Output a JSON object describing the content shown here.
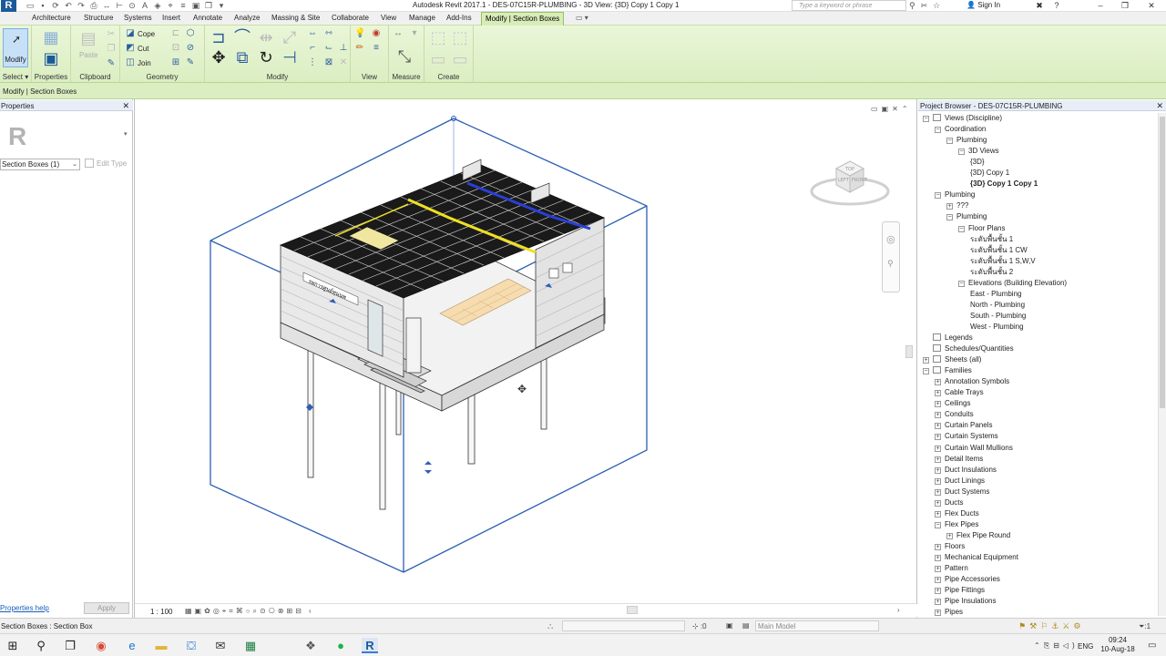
{
  "titlebar": {
    "title": "Autodesk Revit 2017.1 -    DES-07C15R-PLUMBING - 3D View: {3D} Copy 1 Copy 1",
    "search_placeholder": "Type a keyword or phrase",
    "signin": "Sign In",
    "logo": "R"
  },
  "tabs": [
    "Architecture",
    "Structure",
    "Systems",
    "Insert",
    "Annotate",
    "Analyze",
    "Massing & Site",
    "Collaborate",
    "View",
    "Manage",
    "Add-Ins",
    "Modify | Section Boxes"
  ],
  "ribbon": {
    "modify_label": "Modify",
    "paste_label": "Paste",
    "cope_label": "Cope",
    "cut_label": "Cut",
    "join_label": "Join",
    "panels": [
      "Select",
      "Properties",
      "Clipboard",
      "Geometry",
      "Modify",
      "View",
      "Measure",
      "Create"
    ]
  },
  "options_bar": {
    "context": "Modify | Section Boxes"
  },
  "properties": {
    "header": "Properties",
    "type_selector": "Section Boxes (1)",
    "edit_type": "Edit Type",
    "help_link": "Properties help",
    "apply_button": "Apply"
  },
  "view": {
    "scale": "1 : 100",
    "viewcube_top": "TOP",
    "viewcube_left": "LEFT",
    "viewcube_front": "FRONT",
    "building_sign": "รพการศูนย์ทุนนพ"
  },
  "browser": {
    "header": "Project Browser - DES-07C15R-PLUMBING",
    "items": [
      {
        "label": "Views (Discipline)",
        "indent": 0,
        "toggle": "-",
        "icon": "views"
      },
      {
        "label": "Coordination",
        "indent": 1,
        "toggle": "-"
      },
      {
        "label": "Plumbing",
        "indent": 2,
        "toggle": "-"
      },
      {
        "label": "3D Views",
        "indent": 3,
        "toggle": "-"
      },
      {
        "label": "{3D}",
        "indent": 4,
        "toggle": ""
      },
      {
        "label": "{3D} Copy 1",
        "indent": 4,
        "toggle": ""
      },
      {
        "label": "{3D} Copy 1 Copy 1",
        "indent": 4,
        "toggle": "",
        "bold": true
      },
      {
        "label": "Plumbing",
        "indent": 1,
        "toggle": "-"
      },
      {
        "label": "???",
        "indent": 2,
        "toggle": "+"
      },
      {
        "label": "Plumbing",
        "indent": 2,
        "toggle": "-"
      },
      {
        "label": "Floor Plans",
        "indent": 3,
        "toggle": "-"
      },
      {
        "label": "ระดับพื้นชั้น 1",
        "indent": 4,
        "toggle": ""
      },
      {
        "label": "ระดับพื้นชั้น 1 CW",
        "indent": 4,
        "toggle": ""
      },
      {
        "label": "ระดับพื้นชั้น 1 S,W,V",
        "indent": 4,
        "toggle": ""
      },
      {
        "label": "ระดับพื้นชั้น 2",
        "indent": 4,
        "toggle": ""
      },
      {
        "label": "Elevations (Building Elevation)",
        "indent": 3,
        "toggle": "-"
      },
      {
        "label": "East - Plumbing",
        "indent": 4,
        "toggle": ""
      },
      {
        "label": "North - Plumbing",
        "indent": 4,
        "toggle": ""
      },
      {
        "label": "South - Plumbing",
        "indent": 4,
        "toggle": ""
      },
      {
        "label": "West - Plumbing",
        "indent": 4,
        "toggle": ""
      },
      {
        "label": "Legends",
        "indent": 0,
        "toggle": "",
        "icon": "legends"
      },
      {
        "label": "Schedules/Quantities",
        "indent": 0,
        "toggle": "",
        "icon": "schedules"
      },
      {
        "label": "Sheets (all)",
        "indent": 0,
        "toggle": "+",
        "icon": "sheets"
      },
      {
        "label": "Families",
        "indent": 0,
        "toggle": "-",
        "icon": "families"
      },
      {
        "label": "Annotation Symbols",
        "indent": 1,
        "toggle": "+"
      },
      {
        "label": "Cable Trays",
        "indent": 1,
        "toggle": "+"
      },
      {
        "label": "Ceilings",
        "indent": 1,
        "toggle": "+"
      },
      {
        "label": "Conduits",
        "indent": 1,
        "toggle": "+"
      },
      {
        "label": "Curtain Panels",
        "indent": 1,
        "toggle": "+"
      },
      {
        "label": "Curtain Systems",
        "indent": 1,
        "toggle": "+"
      },
      {
        "label": "Curtain Wall Mullions",
        "indent": 1,
        "toggle": "+"
      },
      {
        "label": "Detail Items",
        "indent": 1,
        "toggle": "+"
      },
      {
        "label": "Duct Insulations",
        "indent": 1,
        "toggle": "+"
      },
      {
        "label": "Duct Linings",
        "indent": 1,
        "toggle": "+"
      },
      {
        "label": "Duct Systems",
        "indent": 1,
        "toggle": "+"
      },
      {
        "label": "Ducts",
        "indent": 1,
        "toggle": "+"
      },
      {
        "label": "Flex Ducts",
        "indent": 1,
        "toggle": "+"
      },
      {
        "label": "Flex Pipes",
        "indent": 1,
        "toggle": "-"
      },
      {
        "label": "Flex Pipe Round",
        "indent": 2,
        "toggle": "+"
      },
      {
        "label": "Floors",
        "indent": 1,
        "toggle": "+"
      },
      {
        "label": "Mechanical Equipment",
        "indent": 1,
        "toggle": "+"
      },
      {
        "label": "Pattern",
        "indent": 1,
        "toggle": "+"
      },
      {
        "label": "Pipe Accessories",
        "indent": 1,
        "toggle": "+"
      },
      {
        "label": "Pipe Fittings",
        "indent": 1,
        "toggle": "+"
      },
      {
        "label": "Pipe Insulations",
        "indent": 1,
        "toggle": "+"
      },
      {
        "label": "Pipes",
        "indent": 1,
        "toggle": "+"
      }
    ]
  },
  "status": {
    "message": "Section Boxes : Section Box",
    "selection_count": ":0",
    "model": "Main Model",
    "filter": ":1"
  },
  "taskbar": {
    "language": "ENG",
    "time": "09:24",
    "date": "10-Aug-18"
  },
  "colors": {
    "ribbon": "#dbeec2",
    "section_box": "#2d5fb3",
    "accent_blue": "#1b5a9a"
  }
}
